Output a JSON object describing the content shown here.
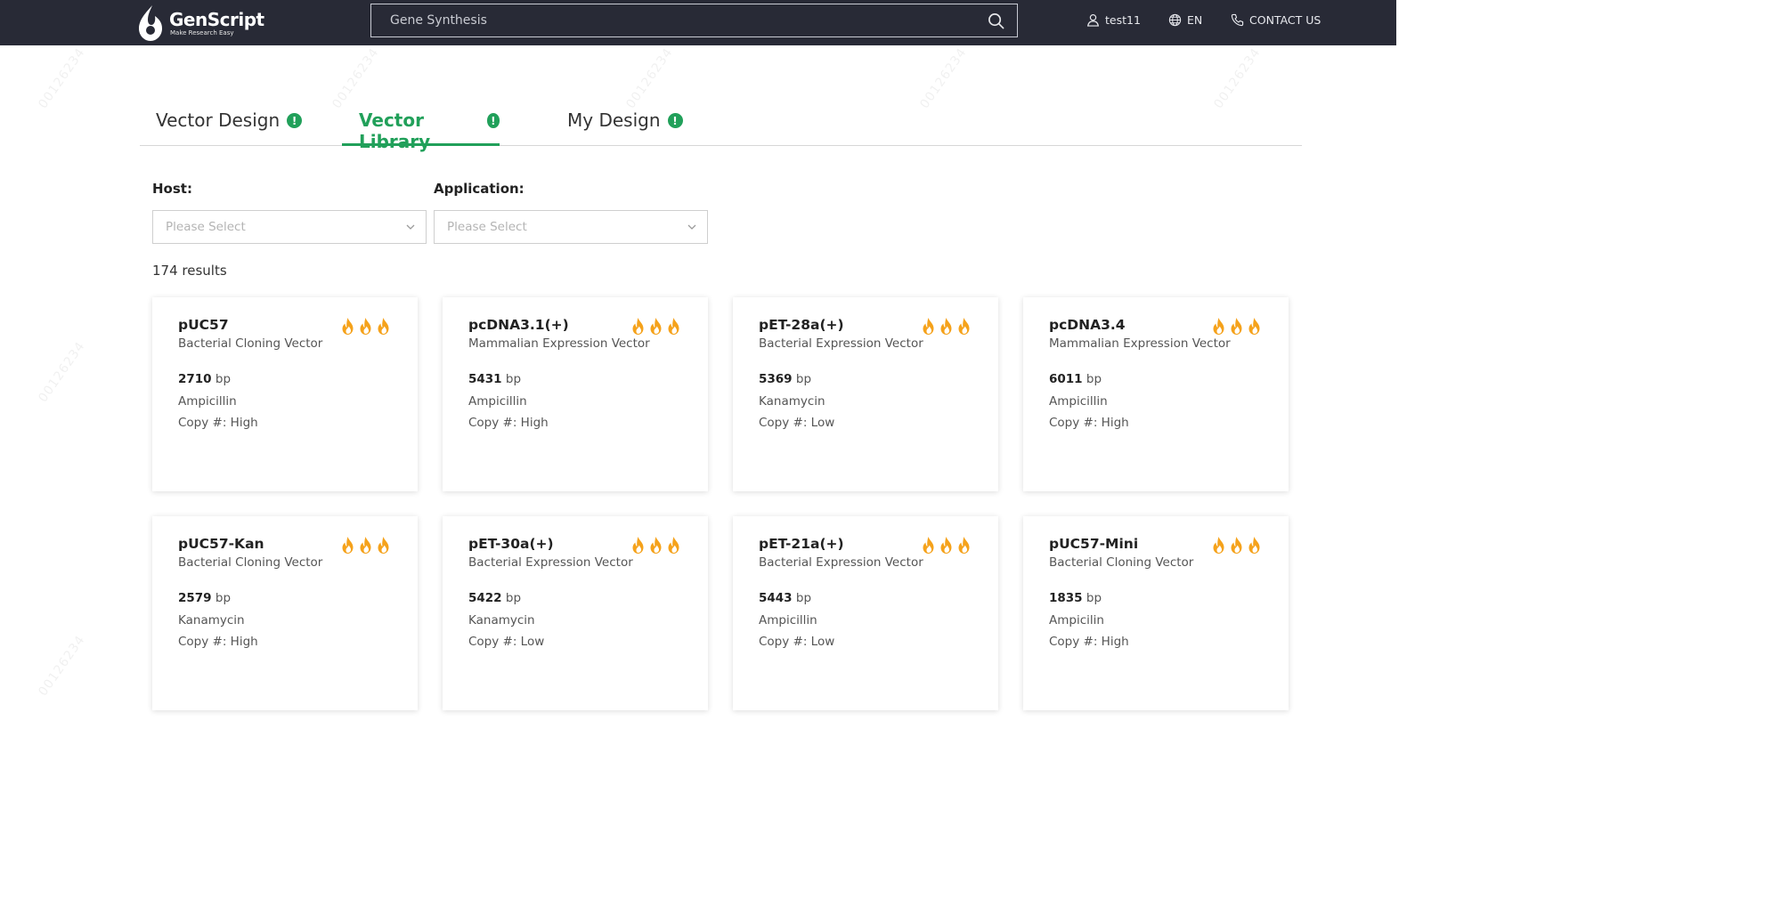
{
  "header": {
    "brand": "GenScript",
    "tagline": "Make Research Easy",
    "search_placeholder": "Gene Synthesis",
    "user": "test11",
    "language": "EN",
    "contact": "CONTACT US"
  },
  "tabs": [
    {
      "label": "Vector Design",
      "active": false
    },
    {
      "label": "Vector Library",
      "active": true
    },
    {
      "label": "My Design",
      "active": false
    }
  ],
  "filters": {
    "host_label": "Host:",
    "host_placeholder": "Please Select",
    "application_label": "Application:",
    "application_placeholder": "Please Select"
  },
  "results_text": "174 results",
  "bp_unit": "bp",
  "cards": [
    {
      "name": "pUC57",
      "type": "Bacterial Cloning Vector",
      "size": "2710",
      "resistance": "Ampicillin",
      "copy": "Copy #: High"
    },
    {
      "name": "pcDNA3.1(+)",
      "type": "Mammalian Expression Vector",
      "size": "5431",
      "resistance": "Ampicillin",
      "copy": "Copy #: High"
    },
    {
      "name": "pET-28a(+)",
      "type": "Bacterial Expression Vector",
      "size": "5369",
      "resistance": "Kanamycin",
      "copy": "Copy #: Low"
    },
    {
      "name": "pcDNA3.4",
      "type": "Mammalian Expression Vector",
      "size": "6011",
      "resistance": "Ampicillin",
      "copy": "Copy #: High"
    },
    {
      "name": "pUC57-Kan",
      "type": "Bacterial Cloning Vector",
      "size": "2579",
      "resistance": "Kanamycin",
      "copy": "Copy #: High"
    },
    {
      "name": "pET-30a(+)",
      "type": "Bacterial Expression Vector",
      "size": "5422",
      "resistance": "Kanamycin",
      "copy": "Copy #: Low"
    },
    {
      "name": "pET-21a(+)",
      "type": "Bacterial Expression Vector",
      "size": "5443",
      "resistance": "Ampicillin",
      "copy": "Copy #: Low"
    },
    {
      "name": "pUC57-Mini",
      "type": "Bacterial Cloning Vector",
      "size": "1835",
      "resistance": "Ampicilin",
      "copy": "Copy #: High"
    }
  ],
  "watermark": "00126234",
  "colors": {
    "header_bg": "#282a36",
    "accent_green": "#21a05a",
    "flame_orange": "#f5a21b"
  },
  "icons": {
    "search": "search-icon",
    "user": "user-icon",
    "globe": "globe-icon",
    "phone": "phone-icon",
    "info": "info-icon",
    "chevron": "chevron-down-icon",
    "flame": "flame-icon"
  }
}
